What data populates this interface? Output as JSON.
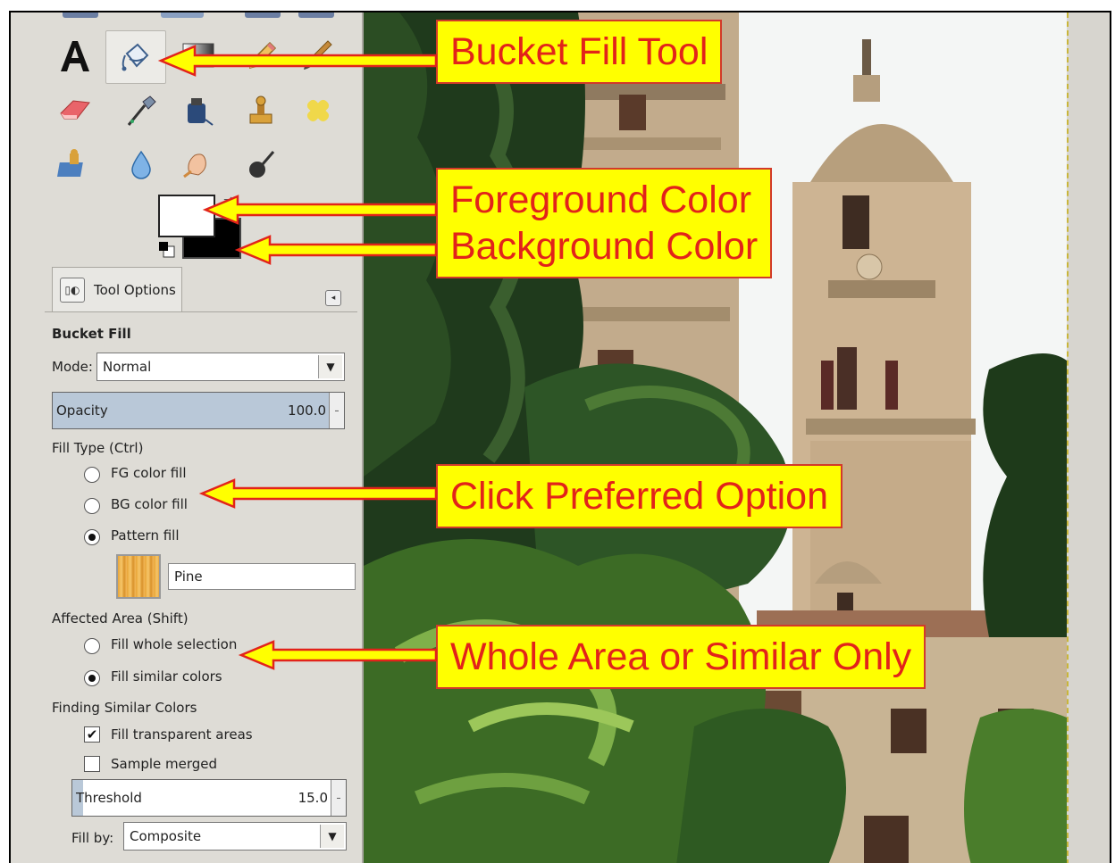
{
  "tool_options": {
    "tab_label": "Tool Options",
    "tool_name": "Bucket Fill",
    "mode_label": "Mode:",
    "mode_value": "Normal",
    "opacity_label": "Opacity",
    "opacity_value": "100.0",
    "fill_type_label": "Fill Type  (Ctrl)",
    "fill_type_options": [
      "FG color fill",
      "BG color fill",
      "Pattern fill"
    ],
    "fill_type_selected": "Pattern fill",
    "pattern_name": "Pine",
    "affected_area_label": "Affected Area  (Shift)",
    "affected_area_options": [
      "Fill whole selection",
      "Fill similar colors"
    ],
    "affected_area_selected": "Fill similar colors",
    "finding_label": "Finding Similar Colors",
    "fill_transparent_label": "Fill transparent areas",
    "fill_transparent_checked": true,
    "sample_merged_label": "Sample merged",
    "sample_merged_checked": false,
    "threshold_label": "Threshold",
    "threshold_value": "15.0",
    "fill_by_label": "Fill by:",
    "fill_by_value": "Composite"
  },
  "colors": {
    "foreground": "#ffffff",
    "background": "#000000",
    "callout_fill": "#ffff00",
    "callout_text": "#e2231a"
  },
  "callouts": {
    "bucket_fill": "Bucket Fill Tool",
    "foreground": "Foreground Color",
    "background": "Background Color",
    "preferred_option": "Click Preferred Option",
    "area": "Whole Area or Similar Only"
  },
  "toolbox_icons": [
    "text-tool-icon",
    "bucket-fill-tool-icon",
    "blend-tool-icon",
    "pencil-tool-icon",
    "paintbrush-tool-icon",
    "eraser-tool-icon",
    "airbrush-tool-icon",
    "ink-tool-icon",
    "clone-tool-icon",
    "heal-tool-icon",
    "perspective-clone-tool-icon",
    "blur-tool-icon",
    "smudge-tool-icon",
    "dodge-burn-tool-icon"
  ]
}
